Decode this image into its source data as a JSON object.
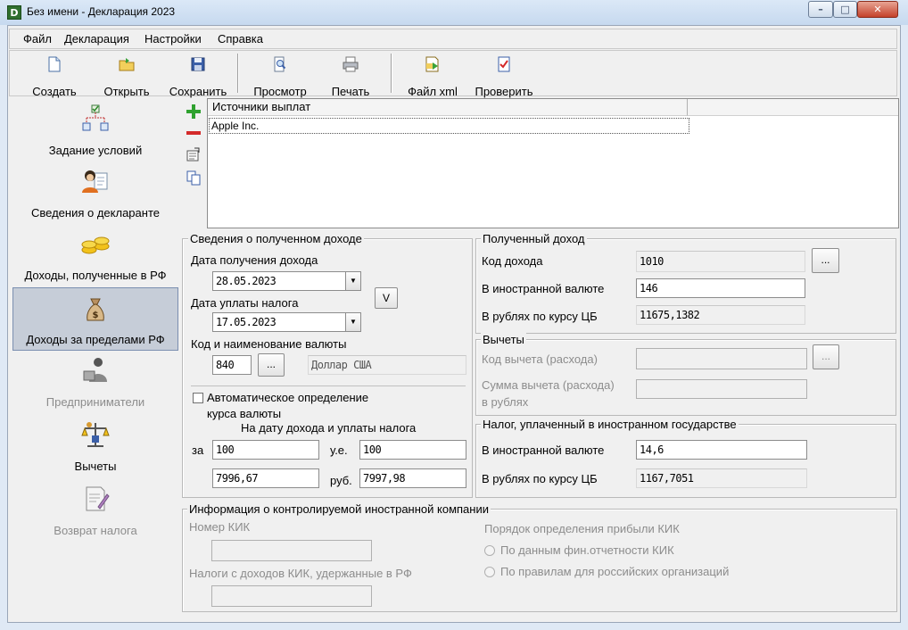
{
  "window": {
    "title": "Без имени - Декларация 2023",
    "app_icon_letter": "D",
    "controls": {
      "minimize": "–",
      "maximize": "□",
      "close": "✕"
    }
  },
  "menu": [
    "Файл",
    "Декларация",
    "Настройки",
    "Справка"
  ],
  "toolbar": [
    {
      "label": "Создать",
      "icon": "new-document-icon"
    },
    {
      "label": "Открыть",
      "icon": "open-folder-icon"
    },
    {
      "label": "Сохранить",
      "icon": "save-disk-icon"
    },
    {
      "label": "Просмотр",
      "icon": "preview-magnifier-icon"
    },
    {
      "label": "Печать",
      "icon": "printer-icon"
    },
    {
      "label": "Файл xml",
      "icon": "xml-export-icon"
    },
    {
      "label": "Проверить",
      "icon": "checklist-icon"
    }
  ],
  "nav": [
    {
      "label": "Задание условий",
      "icon": "conditions-tree-icon",
      "enabled": true,
      "selected": false
    },
    {
      "label": "Сведения о декларанте",
      "icon": "person-card-icon",
      "enabled": true,
      "selected": false
    },
    {
      "label": "Доходы, полученные в РФ",
      "icon": "coins-icon",
      "enabled": true,
      "selected": false
    },
    {
      "label": "Доходы за пределами РФ",
      "icon": "money-bag-icon",
      "enabled": true,
      "selected": true
    },
    {
      "label": "Предприниматели",
      "icon": "entrepreneur-icon",
      "enabled": false,
      "selected": false
    },
    {
      "label": "Вычеты",
      "icon": "scales-icon",
      "enabled": true,
      "selected": false
    },
    {
      "label": "Возврат налога",
      "icon": "document-pen-icon",
      "enabled": false,
      "selected": false
    }
  ],
  "side_actions": [
    "add-icon",
    "remove-icon",
    "edit-icon",
    "copy-icon"
  ],
  "sources": {
    "header": "Источники выплат",
    "rows": [
      "Apple Inc."
    ]
  },
  "income_info": {
    "title": "Сведения о полученном доходе",
    "date_income_label": "Дата получения дохода",
    "date_income": "28.05.2023",
    "date_tax_label": "Дата уплаты налога",
    "date_tax": "17.05.2023",
    "v_button": "V",
    "currency_label": "Код и наименование валюты",
    "currency_code": "840",
    "currency_pick": "...",
    "currency_name": "Доллар США",
    "auto_rate_label_1": "Автоматическое определение",
    "auto_rate_label_2": "курса валюты",
    "auto_rate_checked": false,
    "rate_header": "На дату дохода и уплаты налога",
    "za": "за",
    "ue": "у.е.",
    "rub": "руб.",
    "units_income": "100",
    "units_tax": "100",
    "rub_income": "7996,67",
    "rub_tax": "7997,98"
  },
  "received_income": {
    "title": "Полученный доход",
    "code_label": "Код дохода",
    "code": "1010",
    "code_pick": "...",
    "foreign_label": "В иностранной валюте",
    "foreign": "146",
    "rub_label": "В рублях по курсу ЦБ",
    "rub": "11675,1382"
  },
  "deductions": {
    "title": "Вычеты",
    "code_label": "Код вычета (расхода)",
    "code": "",
    "code_pick": "...",
    "sum_label_1": "Сумма вычета (расхода)",
    "sum_label_2": "в рублях",
    "sum": ""
  },
  "foreign_tax": {
    "title": "Налог, уплаченный в иностранном государстве",
    "foreign_label": "В иностранной валюте",
    "foreign": "14,6",
    "rub_label": "В рублях по курсу ЦБ",
    "rub": "1167,7051"
  },
  "kik": {
    "title": "Информация о контролируемой иностранной компании",
    "number_label": "Номер КИК",
    "number": "",
    "taxes_label": "Налоги с доходов КИК, удержанные в РФ",
    "taxes": "",
    "profit_label": "Порядок определения прибыли КИК",
    "option_1": "По данным фин.отчетности КИК",
    "option_2": "По правилам для российских организаций"
  },
  "colors": {
    "title_bar": "#c6d9ef",
    "window_bg": "#f0f0f0",
    "nav_selected": "#c6cdd8",
    "disabled_text": "#8c8c8c",
    "close_button": "#c4412b"
  }
}
